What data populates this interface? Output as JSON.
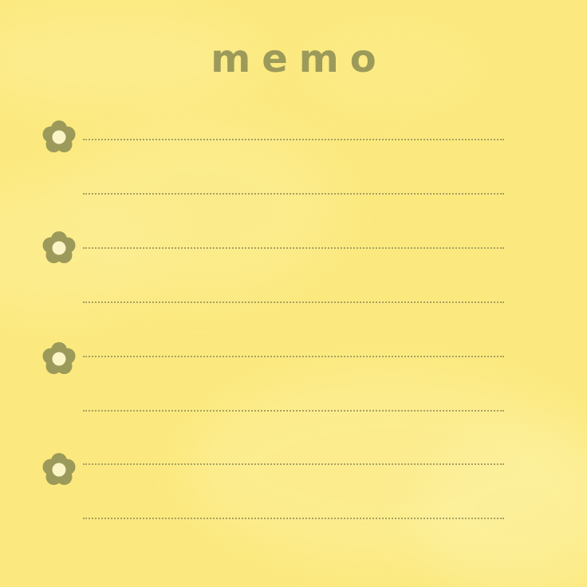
{
  "memo": {
    "title": "memo",
    "lines": [
      {
        "has_flower": true
      },
      {
        "has_flower": false
      },
      {
        "has_flower": true
      },
      {
        "has_flower": false
      },
      {
        "has_flower": true
      },
      {
        "has_flower": false
      },
      {
        "has_flower": true
      },
      {
        "has_flower": false
      }
    ]
  },
  "colors": {
    "background": "#fbe97f",
    "accent": "#9c9a5a",
    "flower_center": "#fbf4c6",
    "dotted_line": "#a7a063"
  },
  "icons": [
    "flower-icon"
  ]
}
